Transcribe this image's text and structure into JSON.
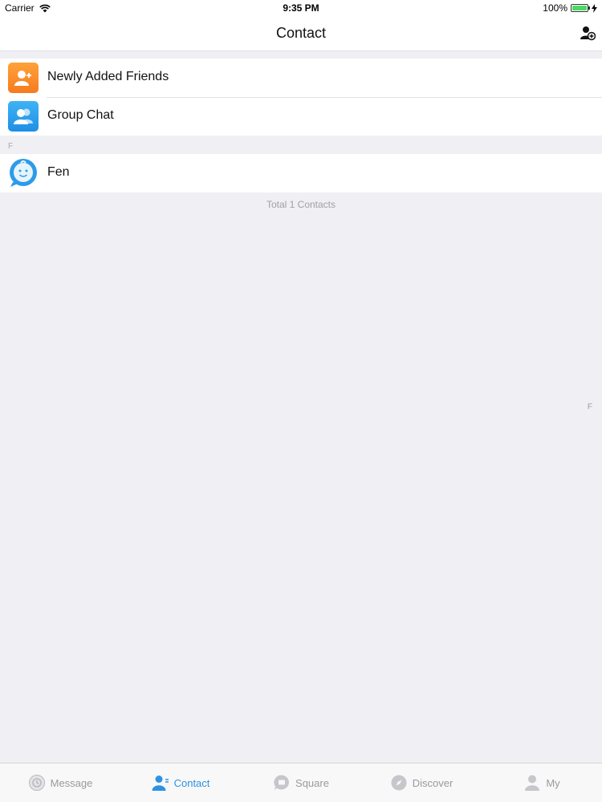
{
  "status_bar": {
    "carrier": "Carrier",
    "time": "9:35 PM",
    "battery": "100%",
    "battery_level": 1.0
  },
  "nav": {
    "title": "Contact",
    "add_contact_icon": "add-contact-icon"
  },
  "quick_items": [
    {
      "label": "Newly Added Friends",
      "icon": "new-friend-icon",
      "color": "#f5871f"
    },
    {
      "label": "Group Chat",
      "icon": "group-chat-icon",
      "color": "#2a9ef0"
    }
  ],
  "sections": [
    {
      "header": "F",
      "contacts": [
        {
          "name": "Fen",
          "icon": "avatar-icon"
        }
      ]
    }
  ],
  "footer": {
    "total": "Total 1 Contacts"
  },
  "index_bar": [
    "F"
  ],
  "tabs": [
    {
      "label": "Message",
      "icon": "message-icon",
      "active": false
    },
    {
      "label": "Contact",
      "icon": "contact-icon",
      "active": true
    },
    {
      "label": "Square",
      "icon": "square-icon",
      "active": false
    },
    {
      "label": "Discover",
      "icon": "discover-icon",
      "active": false
    },
    {
      "label": "My",
      "icon": "my-icon",
      "active": false
    }
  ],
  "colors": {
    "accent": "#2a93e6",
    "background": "#efeff4",
    "inactive_tab": "#9a9a9f"
  }
}
